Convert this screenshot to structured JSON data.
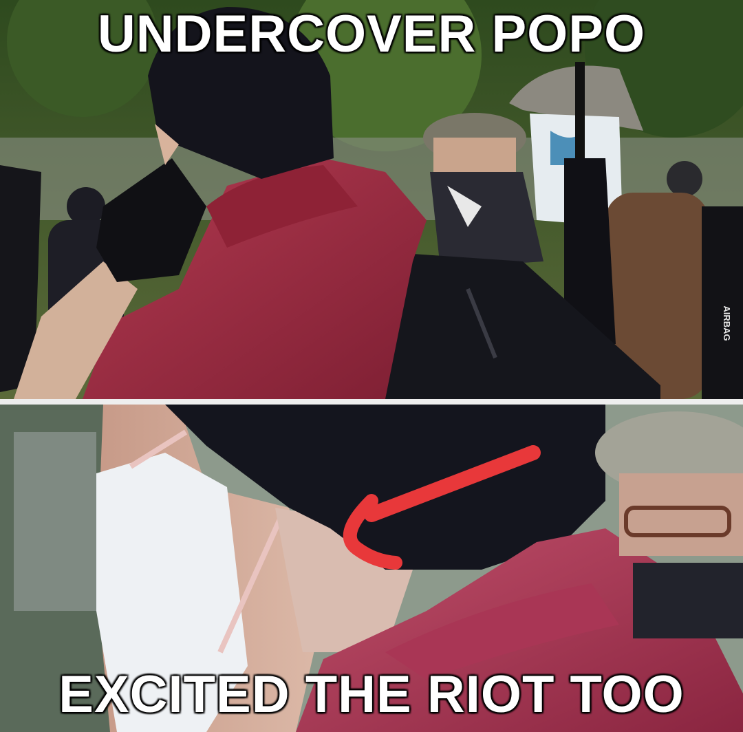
{
  "meme": {
    "top_caption": "UNDERCOVER POPO",
    "bottom_caption": "EXCITED THE RIOT TOO"
  },
  "photo_top": {
    "backpack_strap_text": "AIRBAG",
    "subjects": [
      "black-beanie",
      "red-hoodie",
      "black-backpack",
      "flat-cap-man",
      "bucket-hat-person",
      "umbrella"
    ]
  },
  "photo_bottom": {
    "annotation": "red-arrow",
    "subjects": [
      "face-mask",
      "black-beanie",
      "red-hoodie",
      "flat-cap-man"
    ]
  },
  "colors": {
    "caption_text": "#ffffff",
    "arrow": "#e8383a",
    "hoodie": "#9a2a3e",
    "beanie": "#141420"
  }
}
